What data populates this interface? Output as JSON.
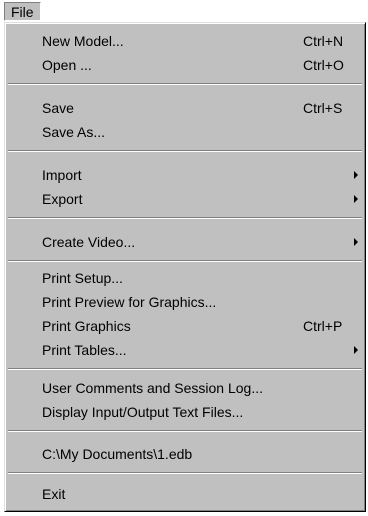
{
  "menubar": {
    "file_label": "File"
  },
  "menu": {
    "new_model": {
      "label": "New Model...",
      "shortcut": "Ctrl+N"
    },
    "open": {
      "label": "Open ...",
      "shortcut": "Ctrl+O"
    },
    "save": {
      "label": "Save",
      "shortcut": "Ctrl+S"
    },
    "save_as": {
      "label": "Save As..."
    },
    "import": {
      "label": "Import",
      "icon": "submenu-arrow-icon"
    },
    "export": {
      "label": "Export",
      "icon": "submenu-arrow-icon"
    },
    "create_video": {
      "label": "Create Video...",
      "icon": "submenu-arrow-icon"
    },
    "print_setup": {
      "label": "Print Setup..."
    },
    "print_preview": {
      "label": "Print Preview for Graphics..."
    },
    "print_graphics": {
      "label": "Print Graphics",
      "shortcut": "Ctrl+P"
    },
    "print_tables": {
      "label": "Print Tables...",
      "icon": "submenu-arrow-icon"
    },
    "user_comments": {
      "label": "User Comments and Session Log..."
    },
    "display_io": {
      "label": "Display Input/Output Text Files..."
    },
    "recent_file": {
      "label": "C:\\My Documents\\1.edb"
    },
    "exit": {
      "label": "Exit"
    }
  },
  "colors": {
    "menu_background": "#c0c0c0",
    "separator_shadow": "#808080",
    "separator_highlight": "#ffffff"
  }
}
